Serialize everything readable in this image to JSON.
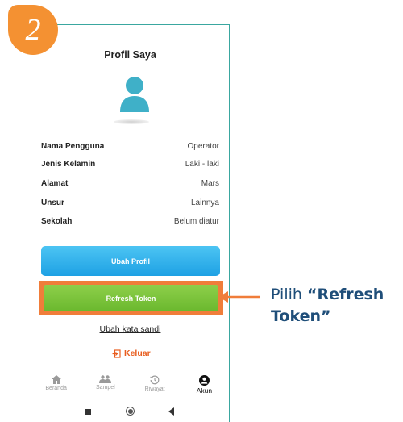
{
  "step": {
    "number": "2"
  },
  "profile": {
    "title": "Profil Saya",
    "fields": [
      {
        "label": "Nama Pengguna",
        "value": "Operator"
      },
      {
        "label": "Jenis Kelamin",
        "value": "Laki - laki"
      },
      {
        "label": "Alamat",
        "value": "Mars"
      },
      {
        "label": "Unsur",
        "value": "Lainnya"
      },
      {
        "label": "Sekolah",
        "value": "Belum diatur"
      }
    ]
  },
  "buttons": {
    "edit_profile": "Ubah Profil",
    "refresh_token": "Refresh Token",
    "change_password": "Ubah kata sandi",
    "logout": "Keluar"
  },
  "nav": {
    "items": [
      {
        "label": "Beranda",
        "icon": "home-icon",
        "active": false
      },
      {
        "label": "Sampel",
        "icon": "people-icon",
        "active": false
      },
      {
        "label": "Riwayat",
        "icon": "history-icon",
        "active": false
      },
      {
        "label": "Akun",
        "icon": "account-icon",
        "active": true
      }
    ]
  },
  "annotation": {
    "prefix": "Pilih ",
    "emphasis": "“Refresh Token”"
  },
  "colors": {
    "accent_orange": "#f07d3a",
    "edit_button_blue": "#1ea1e4",
    "refresh_button_green": "#7ec33c",
    "logout_red": "#e85d1e",
    "callout_text": "#1f4e79",
    "phone_border": "#3aa7a0"
  }
}
